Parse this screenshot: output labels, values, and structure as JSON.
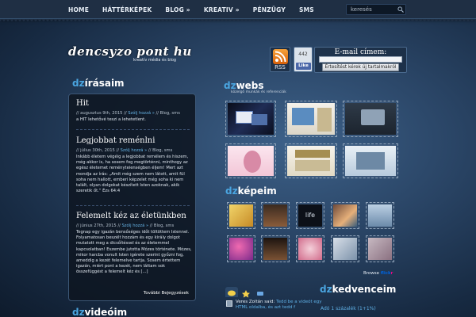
{
  "nav": {
    "items": [
      "HOME",
      "HÁTTÉRKÉPEK",
      "BLOG »",
      "KREATIV »",
      "PÉNZÜGY",
      "SMS"
    ],
    "search_placeholder": "keresés"
  },
  "logo": {
    "title": "dencsyzo pont hu",
    "subtitle": "kreatív média és blog"
  },
  "widgets": {
    "rss_label": "RSS",
    "fb_count": "442",
    "fb_like": "Like",
    "email_title": "E-mail címem:",
    "email_button": "Értesítést kérek új tartalmakról"
  },
  "sections": {
    "irasaim": {
      "pre": "dz",
      "name": "írásaim"
    },
    "webs": {
      "pre": "dz",
      "name": "webs",
      "sub": "közelgő munkák és referenciák"
    },
    "kepeim": {
      "pre": "dz",
      "name": "képeim"
    },
    "videoim": {
      "pre": "dz",
      "name": "videóim"
    },
    "kedvenceim": {
      "pre": "dz",
      "name": "kedvenceim"
    }
  },
  "posts": [
    {
      "title": "Hit",
      "meta1": "// augusztus 9th, 2015 // Szólj hozzá » // Blog, sms",
      "meta_date": "augusztus 9th, 2015",
      "meta_comment": "Szólj hozzá »",
      "meta_cats": "Blog, sms",
      "body": "a HIT lehetővé teszi a lehetetlent."
    },
    {
      "title": "Legjobbat reménlni",
      "meta_date": "július 30th, 2015",
      "meta_comment": "Szólj hozzá »",
      "meta_cats": "Blog, sms",
      "body": "Inkább életem végéig a legjobbat remélem és hiszem, még akkor is, ha sosem fog megtörténni, minthogy az egész életemet reményteienségben éljem! Mert azt mondja az írás: „Amit még szem nem látott, amit fül soha nem hallott, emberi képzelet még soha ki nem talált, olyan dolgokat készített Isten azoknak, akik szeretik őt.” Ézs 64:4"
    },
    {
      "title": "Felemelt kéz az életünkben",
      "meta_date": "június 27th, 2015",
      "meta_comment": "Szólj hozzá »",
      "meta_cats": "Blog, sms",
      "body": "Tegnap egy igazán bensőséges időt töltöttem Istennel. Folyamatosan beszélt hozzám és egy király dolgot mutatott meg a dicsőítéssel és az életemmel kapcsolatban! Eszembe jutotta Mózes története. Mózes, mikor harcba vonult Isten igérete szerint győzni fog, ameddig a kezét felemelve tartja. Sosem értettem igazán, miért pont a kezét, nem láttam sok összefüggést a felemelt kéz és [...]"
    }
  ],
  "more_link": "További Bejegyzések",
  "webs_thumbs": [
    "web-1",
    "web-2",
    "web-3",
    "web-4",
    "web-5",
    "web-6"
  ],
  "photo_thumbs": [
    "photo-1",
    "photo-2",
    "photo-3",
    "photo-4",
    "photo-5",
    "photo-6",
    "photo-7",
    "photo-8",
    "photo-9",
    "photo-10"
  ],
  "photo_text": "life",
  "browse": {
    "prefix": "Browse",
    "flickr_a": "flick",
    "flickr_b": "r"
  },
  "comments": {
    "author": "Veres Zoltán",
    "said": "said:",
    "text": "Tedd be a videót egy HTML oldalba, és azt tedd f"
  },
  "favorites": {
    "link": "Adó 1 százalék (1+1%)"
  },
  "colors": {
    "accent": "#4aa5e0",
    "nav_bg": "#1f2f44",
    "panel_bg": "#0e1621"
  }
}
